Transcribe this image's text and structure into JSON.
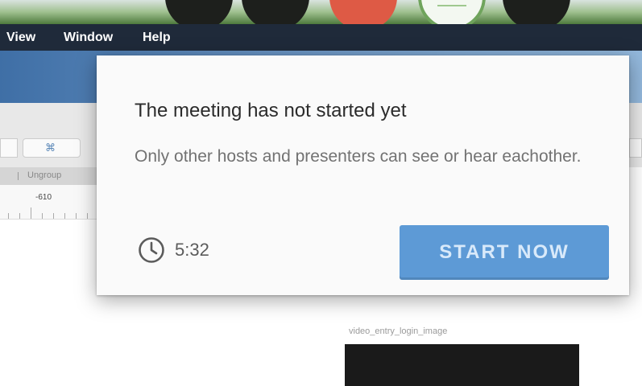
{
  "menu": {
    "items": [
      "View",
      "Window",
      "Help"
    ]
  },
  "toolbar": {
    "ungroup_label": "Ungroup",
    "ruler_value": "-610"
  },
  "canvas": {
    "image_label": "video_entry_login_image"
  },
  "dialog": {
    "title": "The meeting has not started yet",
    "message": "Only other hosts and presenters can see or hear eachother.",
    "timer": "5:32",
    "timer_icon": "clock-icon",
    "start_button": "START NOW"
  },
  "colors": {
    "accent": "#5d9ad6",
    "menubar": "#1f2a3a",
    "end_control": "#de5a45"
  }
}
